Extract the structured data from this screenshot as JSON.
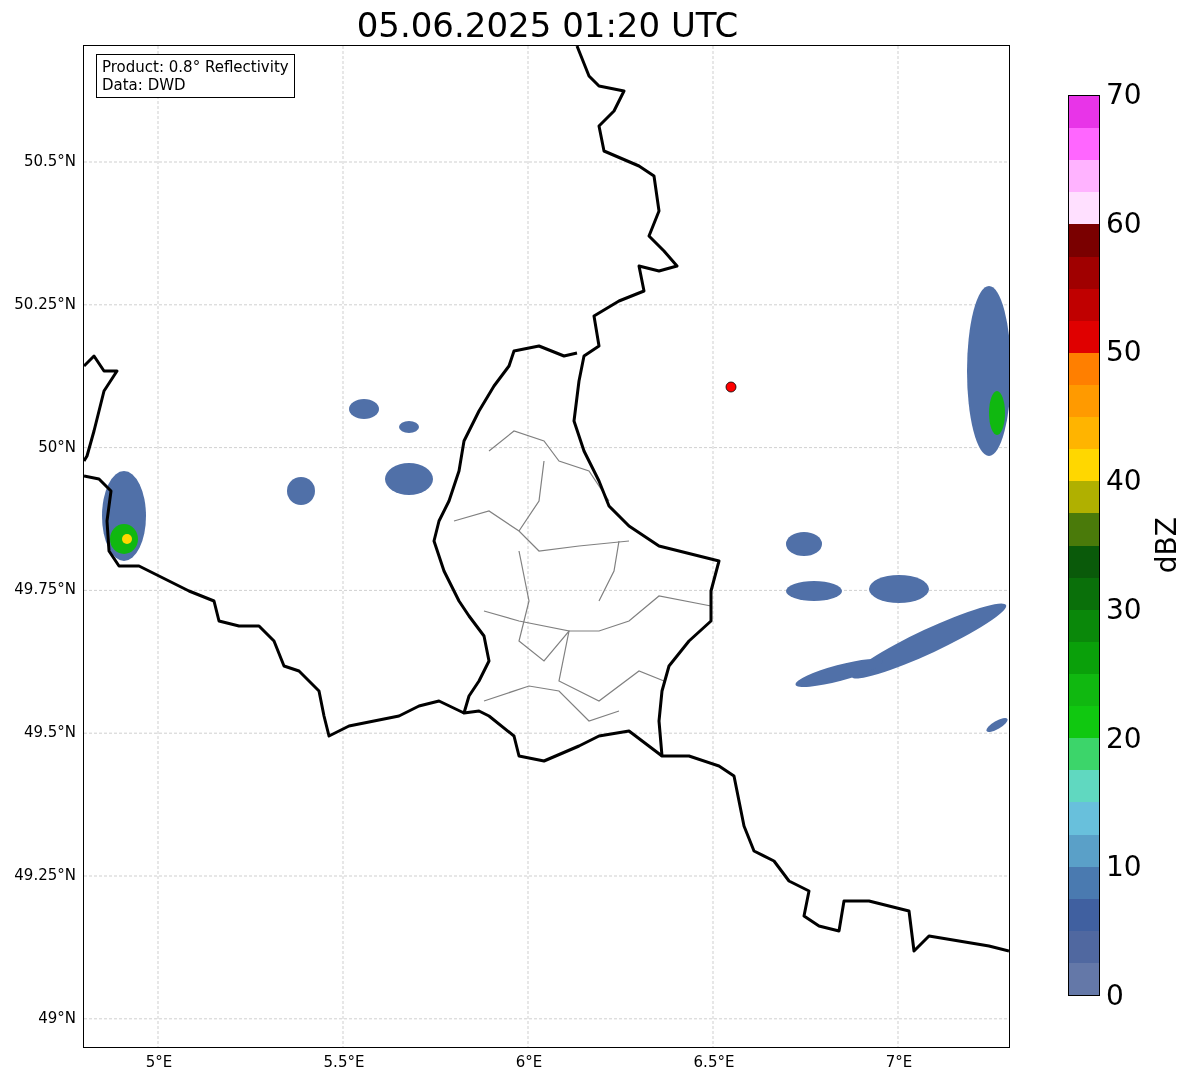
{
  "title": "05.06.2025 01:20 UTC",
  "map": {
    "legend": [
      "Product: 0.8° Reflectivity",
      "Data: DWD"
    ],
    "y_ticks": [
      "50.5°N",
      "50.25°N",
      "50°N",
      "49.75°N",
      "49.5°N",
      "49.25°N",
      "49°N"
    ],
    "x_ticks": [
      "5°E",
      "5.5°E",
      "6°E",
      "6.5°E",
      "7°E"
    ]
  },
  "colorbar": {
    "label": "dBZ",
    "ticks": [
      "70",
      "60",
      "50",
      "40",
      "30",
      "20",
      "10",
      "0"
    ],
    "bins": [
      {
        "color": "#e834e8"
      },
      {
        "color": "#ff66ff"
      },
      {
        "color": "#ffb3ff"
      },
      {
        "color": "#ffe0ff"
      },
      {
        "color": "#7a0000"
      },
      {
        "color": "#a00000"
      },
      {
        "color": "#c00000"
      },
      {
        "color": "#e00000"
      },
      {
        "color": "#ff7f00"
      },
      {
        "color": "#ff9a00"
      },
      {
        "color": "#ffb400"
      },
      {
        "color": "#ffd700"
      },
      {
        "color": "#b0b000"
      },
      {
        "color": "#4a7a0a"
      },
      {
        "color": "#0a5a0a"
      },
      {
        "color": "#0a700a"
      },
      {
        "color": "#0a880a"
      },
      {
        "color": "#0aa00a"
      },
      {
        "color": "#10b810"
      },
      {
        "color": "#10c810"
      },
      {
        "color": "#3cd56a"
      },
      {
        "color": "#60d8c0"
      },
      {
        "color": "#68c0dc"
      },
      {
        "color": "#5aa0c8"
      },
      {
        "color": "#4a7ab0"
      },
      {
        "color": "#4060a0"
      },
      {
        "color": "#5068a0"
      },
      {
        "color": "#6478a8"
      }
    ]
  }
}
